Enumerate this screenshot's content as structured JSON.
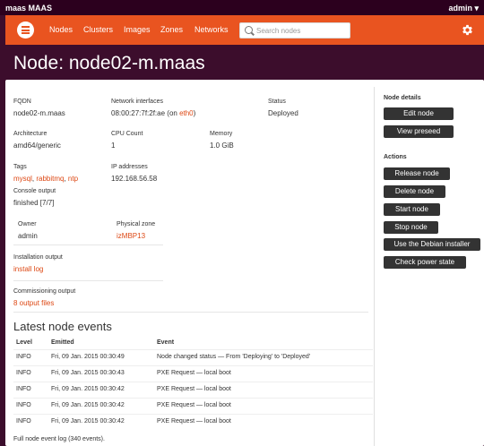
{
  "topbar": {
    "app_title": "maas MAAS",
    "user": "admin ▾"
  },
  "nav": {
    "items": [
      "Nodes",
      "Clusters",
      "Images",
      "Zones",
      "Networks"
    ],
    "search_placeholder": "Search nodes",
    "accent_color": "#e95420"
  },
  "page": {
    "title": "Node: node02-m.maas"
  },
  "details": {
    "fqdn_label": "FQDN",
    "fqdn": "node02-m.maas",
    "interfaces_label": "Network interfaces",
    "interface_mac": "08:00:27:7f:2f:ae (on ",
    "interface_name": "eth0",
    "interface_close": ")",
    "status_label": "Status",
    "status": "Deployed",
    "arch_label": "Architecture",
    "arch": "amd64/generic",
    "cpu_label": "CPU Count",
    "cpu": "1",
    "memory_label": "Memory",
    "memory": "1.0 GiB",
    "tags_label": "Tags",
    "tags": [
      "mysql",
      "rabbitmq",
      "ntp"
    ],
    "ip_label": "IP addresses",
    "ip": "192.168.56.58",
    "console_label": "Console output",
    "console": "finished [7/7]",
    "owner_label": "Owner",
    "owner": "admin",
    "zone_label": "Physical zone",
    "zone": "izMBP13",
    "install_label": "Installation output",
    "install_link": "install log",
    "commission_label": "Commissioning output",
    "commission_link": "8 output files"
  },
  "sidebar": {
    "details_heading": "Node details",
    "edit": "Edit node",
    "view_preseed": "View preseed",
    "actions_heading": "Actions",
    "release": "Release node",
    "delete": "Delete node",
    "start": "Start node",
    "stop": "Stop node",
    "debian_installer": "Use the Debian installer",
    "check_power": "Check power state"
  },
  "events": {
    "title": "Latest node events",
    "columns": [
      "Level",
      "Emitted",
      "Event"
    ],
    "rows": [
      [
        "INFO",
        "Fri, 09 Jan. 2015 00:30:49",
        "Node changed status — From 'Deploying' to 'Deployed'"
      ],
      [
        "INFO",
        "Fri, 09 Jan. 2015 00:30:43",
        "PXE Request — local boot"
      ],
      [
        "INFO",
        "Fri, 09 Jan. 2015 00:30:42",
        "PXE Request — local boot"
      ],
      [
        "INFO",
        "Fri, 09 Jan. 2015 00:30:42",
        "PXE Request — local boot"
      ],
      [
        "INFO",
        "Fri, 09 Jan. 2015 00:30:42",
        "PXE Request — local boot"
      ]
    ],
    "full_log": "Full node event log (340 events)."
  }
}
